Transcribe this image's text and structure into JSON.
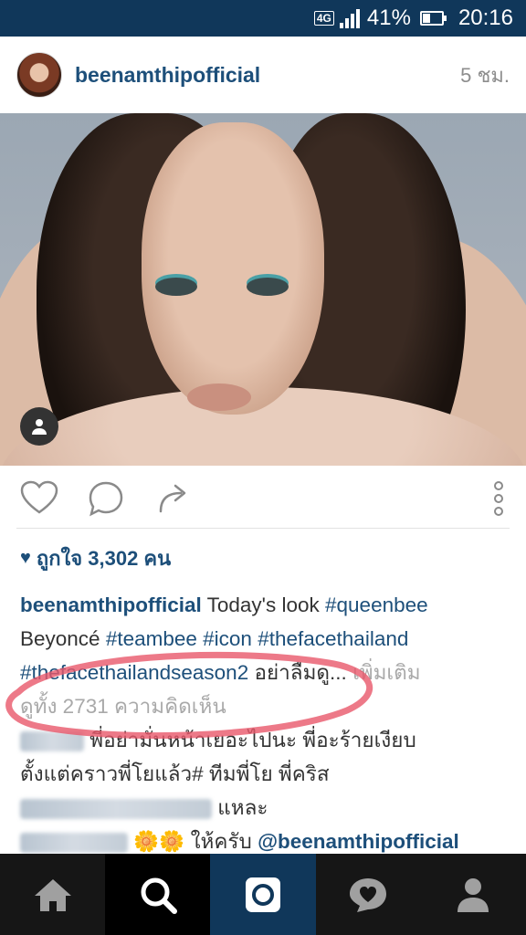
{
  "status_bar": {
    "network": "4G",
    "battery": "41%",
    "battery_level": 0.41,
    "time": "20:16"
  },
  "post": {
    "username": "beenamthipofficial",
    "timestamp": "5 ชม.",
    "likes_text": "ถูกใจ 3,302 คน",
    "caption": {
      "username": "beenamthipofficial",
      "text_line1": "Today's look ",
      "tag_queenbee": "#queenbee",
      "text_line2": "Beyoncé ",
      "tag_teambee": "#teambee",
      "tag_icon": "#icon",
      "tag_thefacethailand": "#thefacethailand",
      "tag_season2": "#thefacethailandseason2",
      "text_tail": "อย่าลืมดู...",
      "more": "เพิ่มเติม"
    },
    "view_comments": "ดูทั้ง 2731 ความคิดเห็น",
    "comments": [
      {
        "text": "พี่อย่ามั่นหน้าเยอะไปนะ  พี่อะร้ายเงียบ",
        "text2": "ตั้งแต่คราวพี่โยแล้ว# ทีมพี่โย  พี่คริส"
      },
      {
        "text": "แหละ"
      },
      {
        "emoji": "🌼🌼",
        "text": "ให้ครับ ",
        "mention": "@beenamthipofficial"
      }
    ]
  },
  "icons": {
    "like": "heart-outline-icon",
    "comment": "comment-bubble-icon",
    "share": "share-arrow-icon",
    "options": "vertical-dots-icon",
    "tagged_user": "person-icon",
    "nav": [
      "home-icon",
      "search-icon",
      "camera-icon",
      "activity-heart-icon",
      "profile-icon"
    ]
  },
  "colors": {
    "status_bar": "#10375a",
    "link_blue": "#1d4f7a",
    "annotation_red": "#e8586a",
    "nav_bg": "#161616"
  }
}
